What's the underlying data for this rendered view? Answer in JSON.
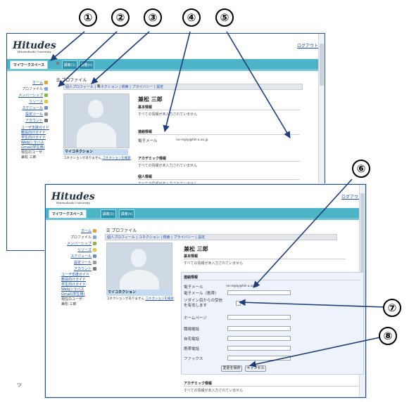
{
  "callouts": [
    "①",
    "②",
    "③",
    "④",
    "⑤",
    "⑥",
    "⑦",
    "⑧"
  ],
  "app": {
    "logo": "Hitudes",
    "logo_sub": "Hitotsubashi University",
    "logout": "ログアウト",
    "logout2": "ログアウト"
  },
  "tabs": {
    "workspace": "マイワークスペース",
    "course1": "講義(1)",
    "course2": "講義(n)"
  },
  "sidebar": {
    "home": "ホーム",
    "profile": "プロファイル",
    "membership": "メンバーシップ",
    "resources": "リソース",
    "schedule": "スケジュール",
    "prefs": "設定ツール",
    "account": "アカウント"
  },
  "quicklinks": {
    "items": [
      "ユーザ支援ガイド",
      "教員向けガイド",
      "学生向けガイド",
      "WebJシラバス",
      "Gmail(学生用)"
    ],
    "users_label": "現在のユーザ：",
    "user": "兼松 三郎"
  },
  "crumb": "プロファイル",
  "toolbar": "個人プロフィール | コネクション | 検索 | プライバシー | 設定",
  "connections": {
    "title": "マイコネクション",
    "note": "コネクションがありません",
    "link": "コネクションを検索"
  },
  "profile": {
    "name": "兼松 三郎",
    "basic": "基本情報",
    "basic_note": "すべての情報が未入力されていません",
    "contact": "連絡情報",
    "email_label": "電子メール",
    "email": "no-reply@hit-u.ac.jp",
    "email_mobile": "電子メール（携帯）",
    "receive": "ソダイン目からの受信を有効します",
    "homepage": "ホームページ",
    "work_phone": "職場電話",
    "home_phone": "自宅電話",
    "mobile": "携帯電話",
    "fax": "ファックス",
    "save": "変更を保存",
    "cancel": "キャンセル",
    "academic": "アカデミック情報",
    "academic_note": "すべての情報が未入力されていません",
    "personal": "個人情報",
    "personal_note": "すべての情報が未入力されていません"
  },
  "stray_char": "ッ"
}
